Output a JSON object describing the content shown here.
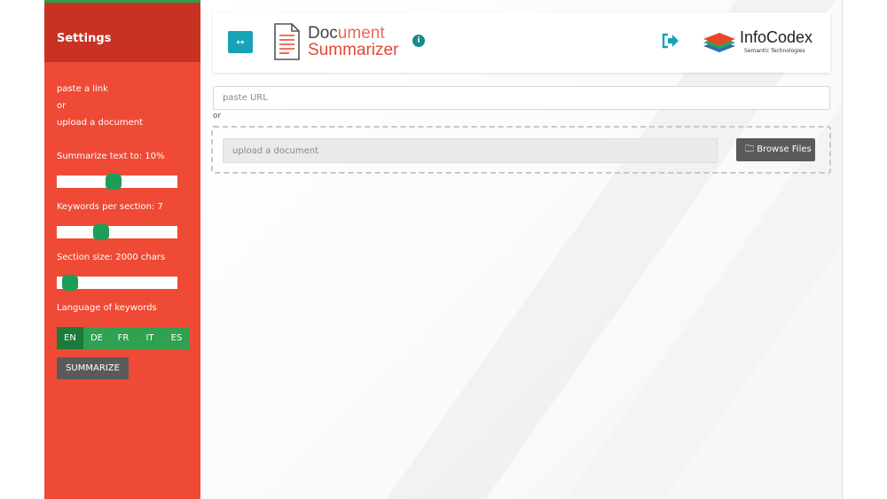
{
  "sidebar": {
    "title": "Settings",
    "instructions": [
      "paste a link",
      "or",
      "upload a document"
    ],
    "summarize_label": "Summarize text to: 10%",
    "summarize_value_pct": 10,
    "keywords_label": "Keywords per section: 7",
    "keywords_value": 7,
    "section_label": "Section size: 2000 chars",
    "section_value": 2000,
    "language_label": "Language of keywords",
    "languages": [
      "EN",
      "DE",
      "FR",
      "IT",
      "ES"
    ],
    "selected_language": "EN",
    "summarize_button": "SUMMARIZE"
  },
  "header": {
    "logo_line1_strong": "Doc",
    "logo_line1_light": "ument",
    "logo_line2": "Summarizer",
    "brand_name": "InfoCodex",
    "brand_tagline": "Semantic Technologies"
  },
  "main": {
    "url_placeholder": "paste URL",
    "or_text": "or",
    "upload_placeholder": "upload a document",
    "browse_label": "Browse Files"
  },
  "icons": {
    "toggle": "toggle-sidebar-icon",
    "document": "document-icon",
    "info": "info-icon",
    "logout": "logout-icon",
    "folder": "folder-icon"
  },
  "colors": {
    "sidebar_bg": "#ef4a35",
    "sidebar_header_bg": "#c93122",
    "slider_thumb": "#1f9d58",
    "lang_bg": "#2fa150",
    "lang_active": "#1a7a39",
    "toggle_button": "#17a2b8",
    "dark_button": "#5a5a5a"
  }
}
